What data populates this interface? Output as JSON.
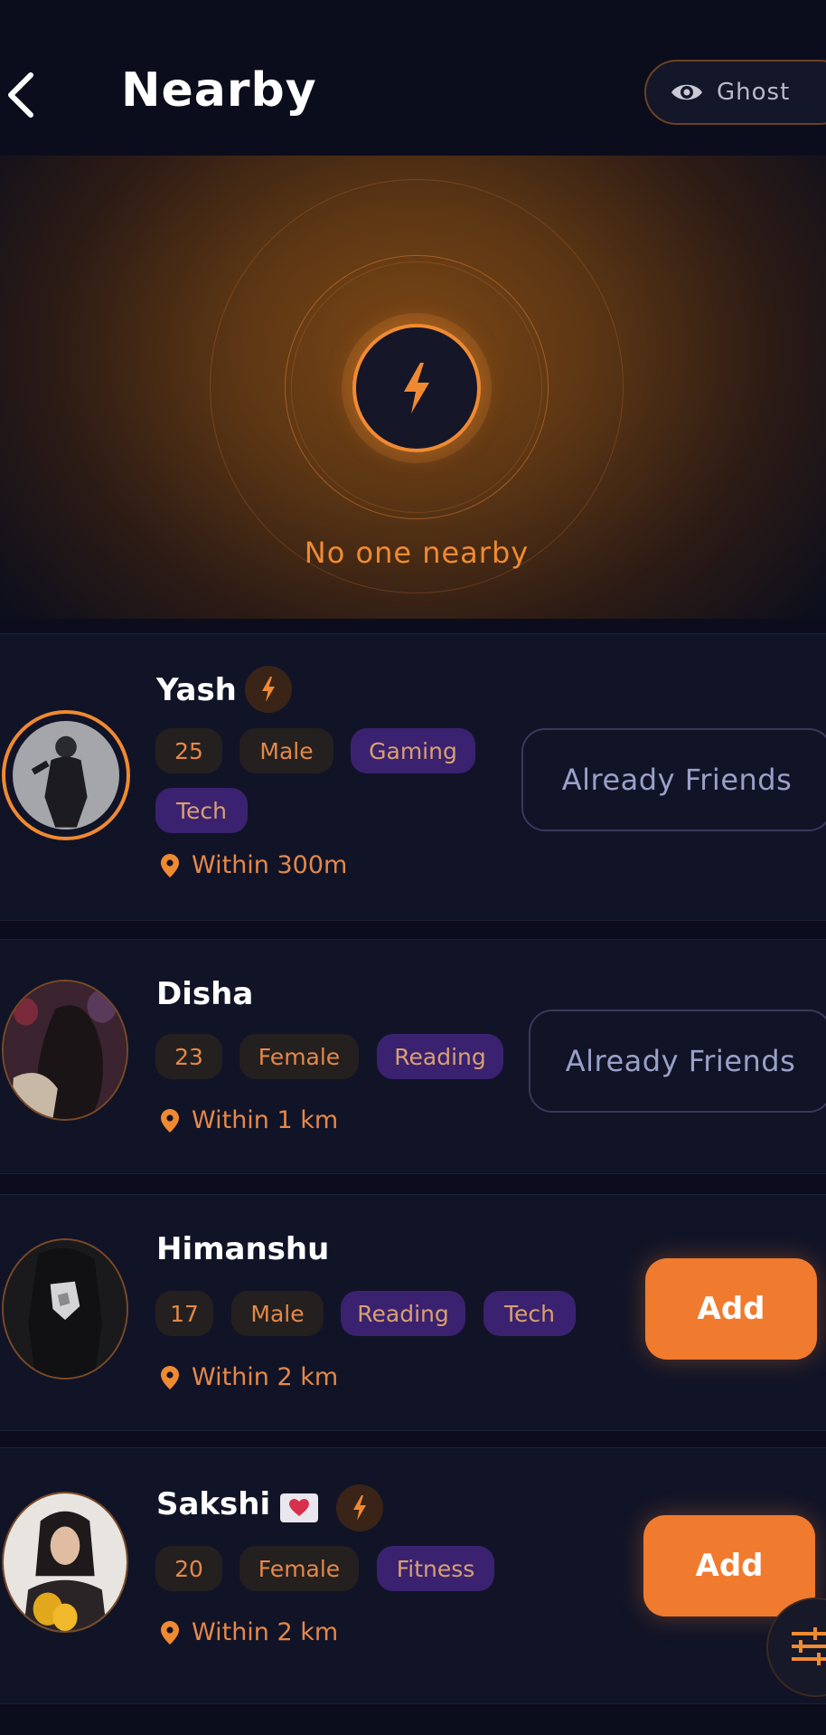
{
  "header": {
    "title": "Nearby",
    "ghost_label": "Ghost"
  },
  "radar": {
    "status": "No one nearby"
  },
  "colors": {
    "accent": "#f08a32",
    "background": "#0b0d1c",
    "card": "#111427",
    "interest_chip": "#3a2270",
    "neutral_chip": "#24201f"
  },
  "users": [
    {
      "name": "Yash",
      "age": "25",
      "gender": "Male",
      "interests": [
        "Gaming",
        "Tech"
      ],
      "distance": "Within 300m",
      "action": "Already Friends",
      "badges": [
        "bolt-icon"
      ]
    },
    {
      "name": "Disha",
      "age": "23",
      "gender": "Female",
      "interests": [
        "Reading"
      ],
      "distance": "Within 1 km",
      "action": "Already Friends",
      "badges": []
    },
    {
      "name": "Himanshu",
      "age": "17",
      "gender": "Male",
      "interests": [
        "Reading",
        "Tech"
      ],
      "distance": "Within 2 km",
      "action": "Add",
      "badges": []
    },
    {
      "name": "Sakshi",
      "age": "20",
      "gender": "Female",
      "interests": [
        "Fitness"
      ],
      "distance": "Within 2 km",
      "action": "Add",
      "badges": [
        "heart-icon",
        "bolt-icon"
      ]
    }
  ]
}
